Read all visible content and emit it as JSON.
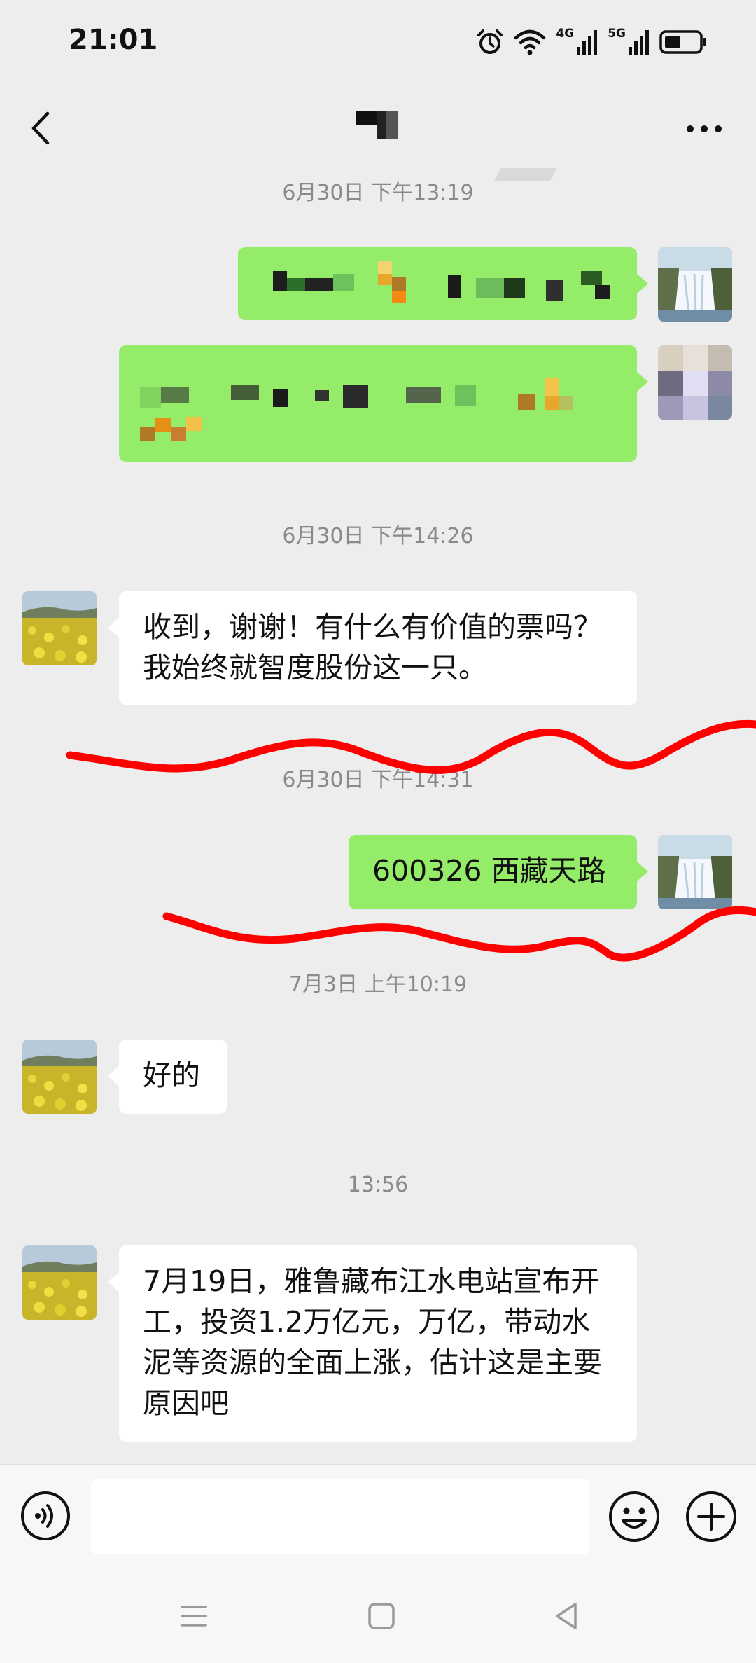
{
  "status_bar": {
    "time": "21:01",
    "network_a": "4G",
    "network_b": "5G",
    "icons": [
      "alarm-icon",
      "wifi-icon",
      "signal-4g-icon",
      "signal-5g-icon",
      "battery-icon"
    ]
  },
  "header": {
    "back_icon": "chevron-left-icon",
    "more_icon": "more-dots-icon"
  },
  "messages": [
    {
      "type": "time",
      "text": "6月30日 下午13:19"
    },
    {
      "type": "outgoing",
      "text": "",
      "obscured": true
    },
    {
      "type": "outgoing",
      "text": "",
      "obscured": true
    },
    {
      "type": "time",
      "text": "6月30日 下午14:26"
    },
    {
      "type": "incoming",
      "text": "收到，谢谢！有什么有价值的票吗？我始终就智度股份这一只。"
    },
    {
      "type": "time",
      "text": "6月30日 下午14:31"
    },
    {
      "type": "outgoing",
      "text": "600326 西藏天路"
    },
    {
      "type": "time",
      "text": "7月3日 上午10:19"
    },
    {
      "type": "incoming",
      "text": "好的"
    },
    {
      "type": "time",
      "text": "13:56"
    },
    {
      "type": "incoming",
      "text": "7月19日，雅鲁藏布江水电站宣布开工，投资1.2万亿元，万亿，带动水泥等资源的全面上涨，估计这是主要原因吧"
    }
  ],
  "input_bar": {
    "value": "",
    "voice_icon": "voice-icon",
    "emoji_icon": "emoji-icon",
    "plus_icon": "plus-icon"
  },
  "colors": {
    "background": "#ededed",
    "outgoing_bubble": "#95ec69",
    "incoming_bubble": "#ffffff",
    "annotation_line": "#ff0000",
    "time_text": "#8a8a8a"
  }
}
